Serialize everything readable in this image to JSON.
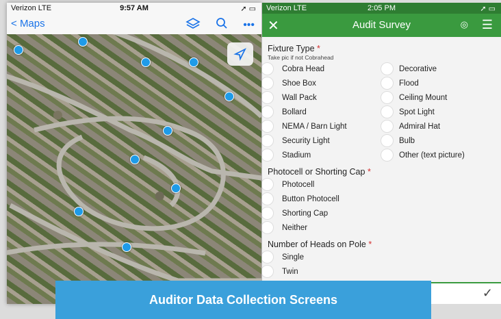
{
  "map_phone": {
    "status": {
      "carrier": "Verizon  LTE",
      "time": "9:57 AM",
      "right": "➚ ▭"
    },
    "nav": {
      "back_label": "Maps",
      "layers_icon": "layers-icon",
      "search_icon": "search-icon",
      "more_label": "•••"
    }
  },
  "survey_phone": {
    "status": {
      "carrier": "Verizon  LTE",
      "time": "2:05 PM",
      "right": "➚ ▭"
    },
    "appbar": {
      "title": "Audit Survey",
      "close_label": "✕",
      "menu_label": "☰",
      "gps_label": "◎"
    },
    "fixture": {
      "title": "Fixture Type",
      "required": "*",
      "hint": "Take pic if not Cobrahead",
      "left_options": [
        "Cobra Head",
        "Shoe Box",
        "Wall Pack",
        "Bollard",
        "NEMA / Barn Light",
        "Security Light",
        "Stadium"
      ],
      "right_options": [
        "Decorative",
        "Flood",
        "Ceiling Mount",
        "Spot Light",
        "Admiral Hat",
        "Bulb",
        "Other (text picture)"
      ]
    },
    "photocell": {
      "title": "Photocell or Shorting Cap",
      "required": "*",
      "options": [
        "Photocell",
        "Button Photocell",
        "Shorting Cap",
        "Neither"
      ]
    },
    "heads": {
      "title": "Number of Heads on Pole",
      "required": "*",
      "options": [
        "Single",
        "Twin"
      ]
    },
    "submit_label": "✓"
  },
  "caption": "Auditor Data Collection Screens",
  "colors": {
    "accent_green": "#3a9a3f",
    "caption_blue": "#3aa0db",
    "pin_blue": "#1e9be8"
  }
}
